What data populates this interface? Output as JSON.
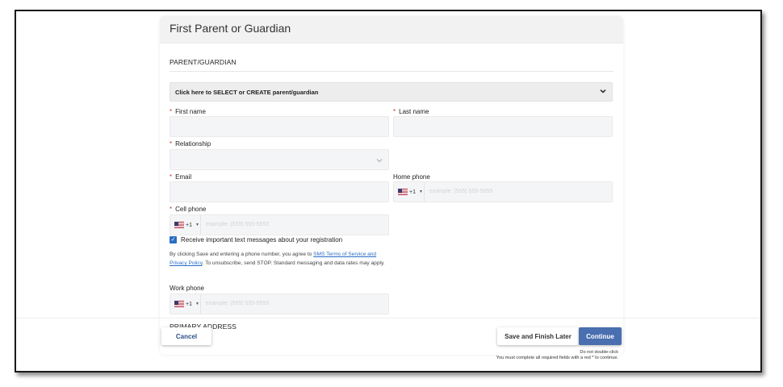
{
  "card": {
    "title": "First Parent or Guardian"
  },
  "parent_section": {
    "heading": "PARENT/GUARDIAN",
    "selector_label": "Click here to SELECT or CREATE parent/guardian"
  },
  "fields": {
    "first_name": {
      "label": "First name",
      "required": "*",
      "value": ""
    },
    "last_name": {
      "label": "Last name",
      "required": "*",
      "value": ""
    },
    "relationship": {
      "label": "Relationship",
      "required": "*",
      "value": ""
    },
    "email": {
      "label": "Email",
      "required": "*",
      "value": ""
    },
    "home_phone": {
      "label": "Home phone",
      "country_code": "+1",
      "placeholder": "example: (555) 555-5555"
    },
    "cell_phone": {
      "label": "Cell phone",
      "required": "*",
      "country_code": "+1",
      "placeholder": "example: (555) 555-5555"
    },
    "work_phone": {
      "label": "Work phone",
      "country_code": "+1",
      "placeholder": "example: (555) 555-5555"
    }
  },
  "sms": {
    "checkbox_label": "Receive important text messages about your registration",
    "checked": true,
    "disclaimer_prefix": "By clicking Save and entering a phone number, you agree to ",
    "link_text": "SMS Terms of Service and Privacy Policy",
    "disclaimer_suffix": ". To unsubscribe, send STOP. Standard messaging and data rates may apply."
  },
  "address_section": {
    "heading": "PRIMARY ADDRESS"
  },
  "footer": {
    "cancel_label": "Cancel",
    "save_label": "Save and Finish Later",
    "continue_label": "Continue",
    "note_double_click": "Do not double-click",
    "note_required": "You must complete all required fields with a red * to continue."
  },
  "colors": {
    "accent": "#4a6fb0",
    "link": "#2a6dc4",
    "required": "#c0392b"
  },
  "icons": [
    "chevron-down-icon",
    "us-flag-icon",
    "checkmark-icon"
  ]
}
